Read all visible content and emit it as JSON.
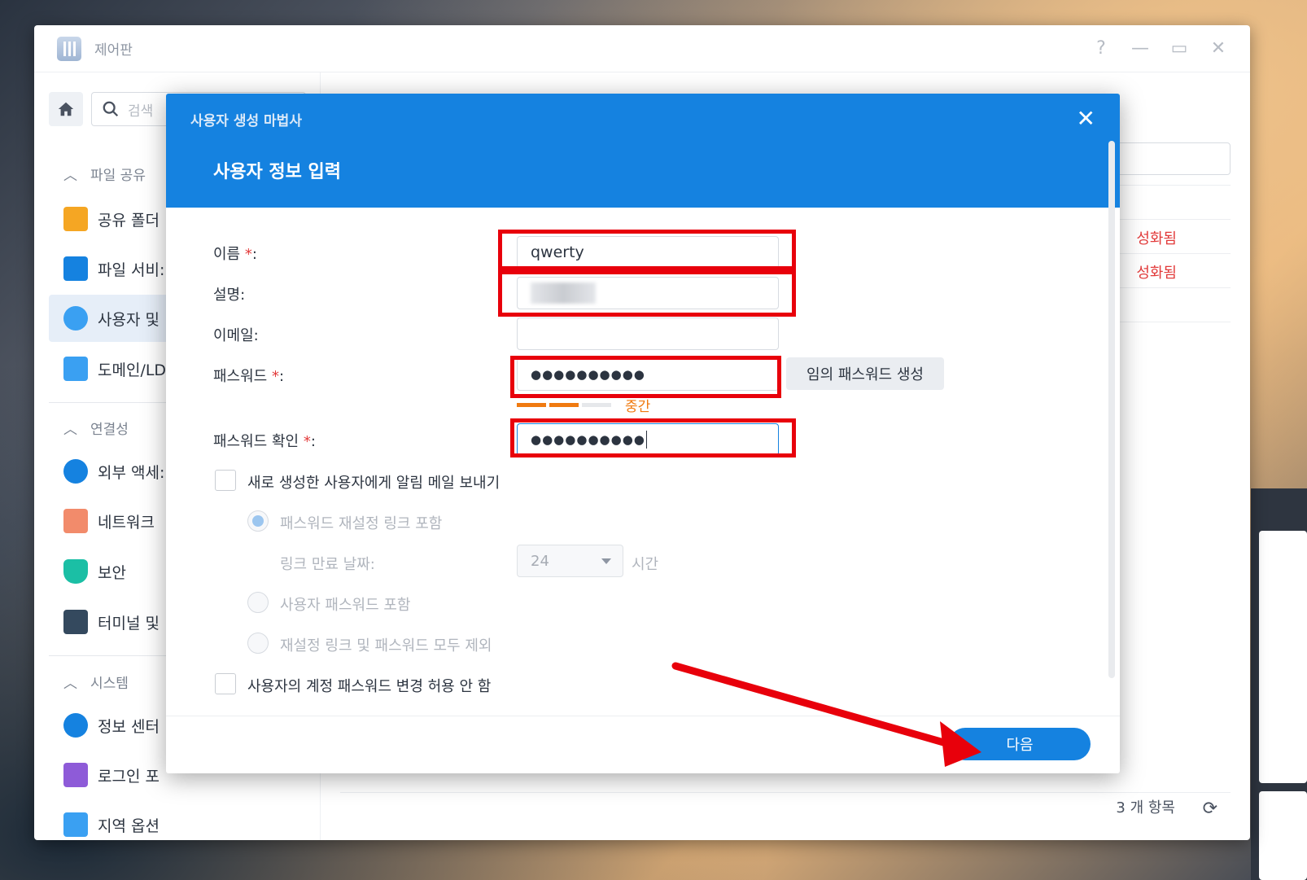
{
  "window": {
    "title": "제어판",
    "controls": [
      "?",
      "—",
      "▭",
      "✕"
    ]
  },
  "sidebar": {
    "search_placeholder": "검색",
    "sections": [
      {
        "label": "파일 공유",
        "items": [
          "공유 폴더",
          "파일 서비:"
        ]
      },
      {
        "label": "연결성",
        "items": [
          "외부 액세:",
          "네트워크",
          "보안",
          "터미널 및"
        ]
      },
      {
        "label": "시스템",
        "items": [
          "정보 센터",
          "로그인 포",
          "지역 옵션"
        ]
      }
    ],
    "active_item": "사용자 및",
    "domain_item": "도메인/LD"
  },
  "main": {
    "status_1": "성화됨",
    "status_2": "성화됨",
    "count": "3 개 항목"
  },
  "dialog": {
    "wizard_title": "사용자 생성 마법사",
    "title": "사용자 정보 입력",
    "fields": {
      "name_label": "이름",
      "name_value": "qwerty",
      "desc_label": "설명:",
      "email_label": "이메일:",
      "password_label": "패스워드",
      "password_value": "●●●●●●●●●●",
      "generate_button": "임의 패스워드 생성",
      "strength_label": "중간",
      "confirm_label": "패스워드 확인",
      "confirm_value": "●●●●●●●●●●"
    },
    "required_mark": "*",
    "colon": ":",
    "options": {
      "notify_email": "새로 생성한 사용자에게 알림 메일 보내기",
      "include_reset_link": "패스워드 재설정 링크 포함",
      "link_expiry_label": "링크 만료 날짜:",
      "link_expiry_value": "24",
      "link_expiry_unit": "시간",
      "include_user_password": "사용자 패스워드 포함",
      "exclude_both": "재설정 링크 및 패스워드 모두 제외",
      "disallow_password_change": "사용자의 계정 패스워드 변경 허용 안 함"
    },
    "next_button": "다음",
    "colors": {
      "header": "#1582e0",
      "highlight": "#e8000b",
      "strength": "#f07a10"
    }
  }
}
